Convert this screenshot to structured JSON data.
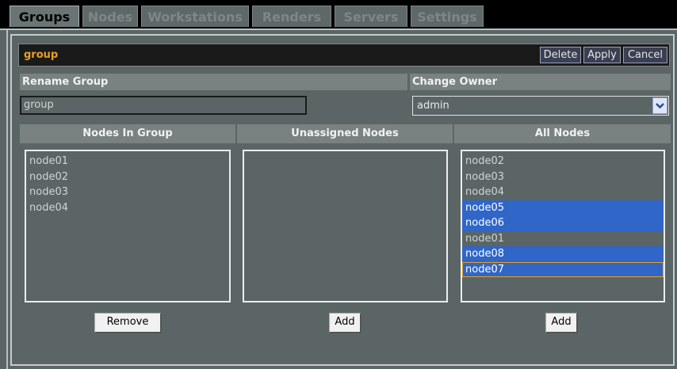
{
  "tabs": [
    {
      "label": "Groups",
      "active": true
    },
    {
      "label": "Nodes",
      "active": false
    },
    {
      "label": "Workstations",
      "active": false
    },
    {
      "label": "Renders",
      "active": false
    },
    {
      "label": "Servers",
      "active": false
    },
    {
      "label": "Settings",
      "active": false
    }
  ],
  "group": {
    "title": "group",
    "delete_label": "Delete",
    "apply_label": "Apply",
    "cancel_label": "Cancel"
  },
  "rename": {
    "heading": "Rename Group",
    "value": "group"
  },
  "owner": {
    "heading": "Change Owner",
    "value": "admin"
  },
  "columns": {
    "in_group": {
      "heading": "Nodes In Group",
      "items": [
        "node01",
        "node02",
        "node03",
        "node04"
      ],
      "button_label": "Remove"
    },
    "unassigned": {
      "heading": "Unassigned Nodes",
      "items": [],
      "button_label": "Add"
    },
    "all": {
      "heading": "All Nodes",
      "items": [
        {
          "label": "node02",
          "selected": false
        },
        {
          "label": "node03",
          "selected": false
        },
        {
          "label": "node04",
          "selected": false
        },
        {
          "label": "node05",
          "selected": true
        },
        {
          "label": "node06",
          "selected": true
        },
        {
          "label": "node01",
          "selected": false
        },
        {
          "label": "node08",
          "selected": true
        },
        {
          "label": "node07",
          "selected": true,
          "focused": true
        }
      ],
      "button_label": "Add"
    }
  },
  "colors": {
    "accent": "#e8a020",
    "selection": "#2f66c8",
    "background": "#5b6565"
  }
}
